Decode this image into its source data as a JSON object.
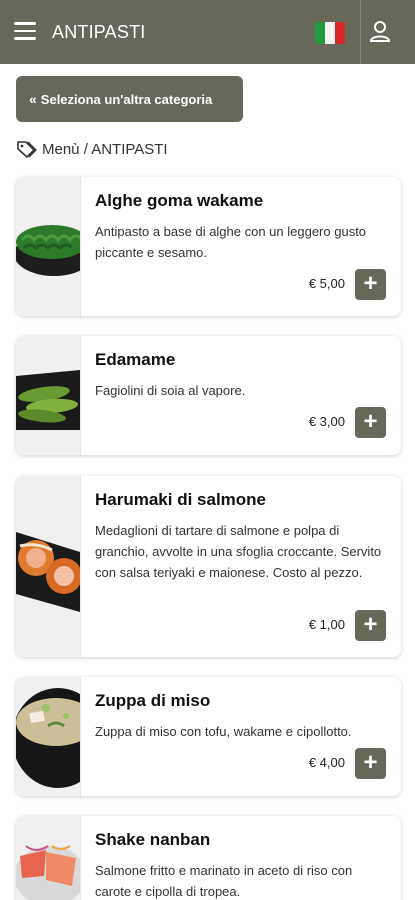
{
  "header": {
    "title": "ANTIPASTI",
    "menu_icon": "hamburger-menu-icon",
    "flag_icon": "italian-flag-icon",
    "user_icon": "user-icon",
    "color": "#68685a"
  },
  "category_button": {
    "label": "Seleziona un'altra categoria",
    "chevron": "«"
  },
  "breadcrumb": {
    "icon": "tag-icon",
    "text": "Menù / ANTIPASTI"
  },
  "products": [
    {
      "name": "Alghe goma wakame",
      "description": "Antipasto a base di alghe con un leggero gusto piccante e sesamo.",
      "price": "€ 5,00"
    },
    {
      "name": "Edamame",
      "description": "Fagiolini di soia al vapore.",
      "price": "€ 3,00"
    },
    {
      "name": "Harumaki di salmone",
      "description": "Medaglioni di tartare di salmone e polpa di granchio, avvolte in una sfoglia croccante. Servito con salsa teriyaki e maionese. Costo al pezzo.",
      "price": "€ 1,00"
    },
    {
      "name": "Zuppa di miso",
      "description": "Zuppa di miso con tofu, wakame e cipollotto.",
      "price": "€ 4,00"
    },
    {
      "name": "Shake nanban",
      "description": "Salmone fritto e marinato in aceto di riso con carote e cipolla di tropea.",
      "price": ""
    }
  ],
  "add_button_label": "+"
}
